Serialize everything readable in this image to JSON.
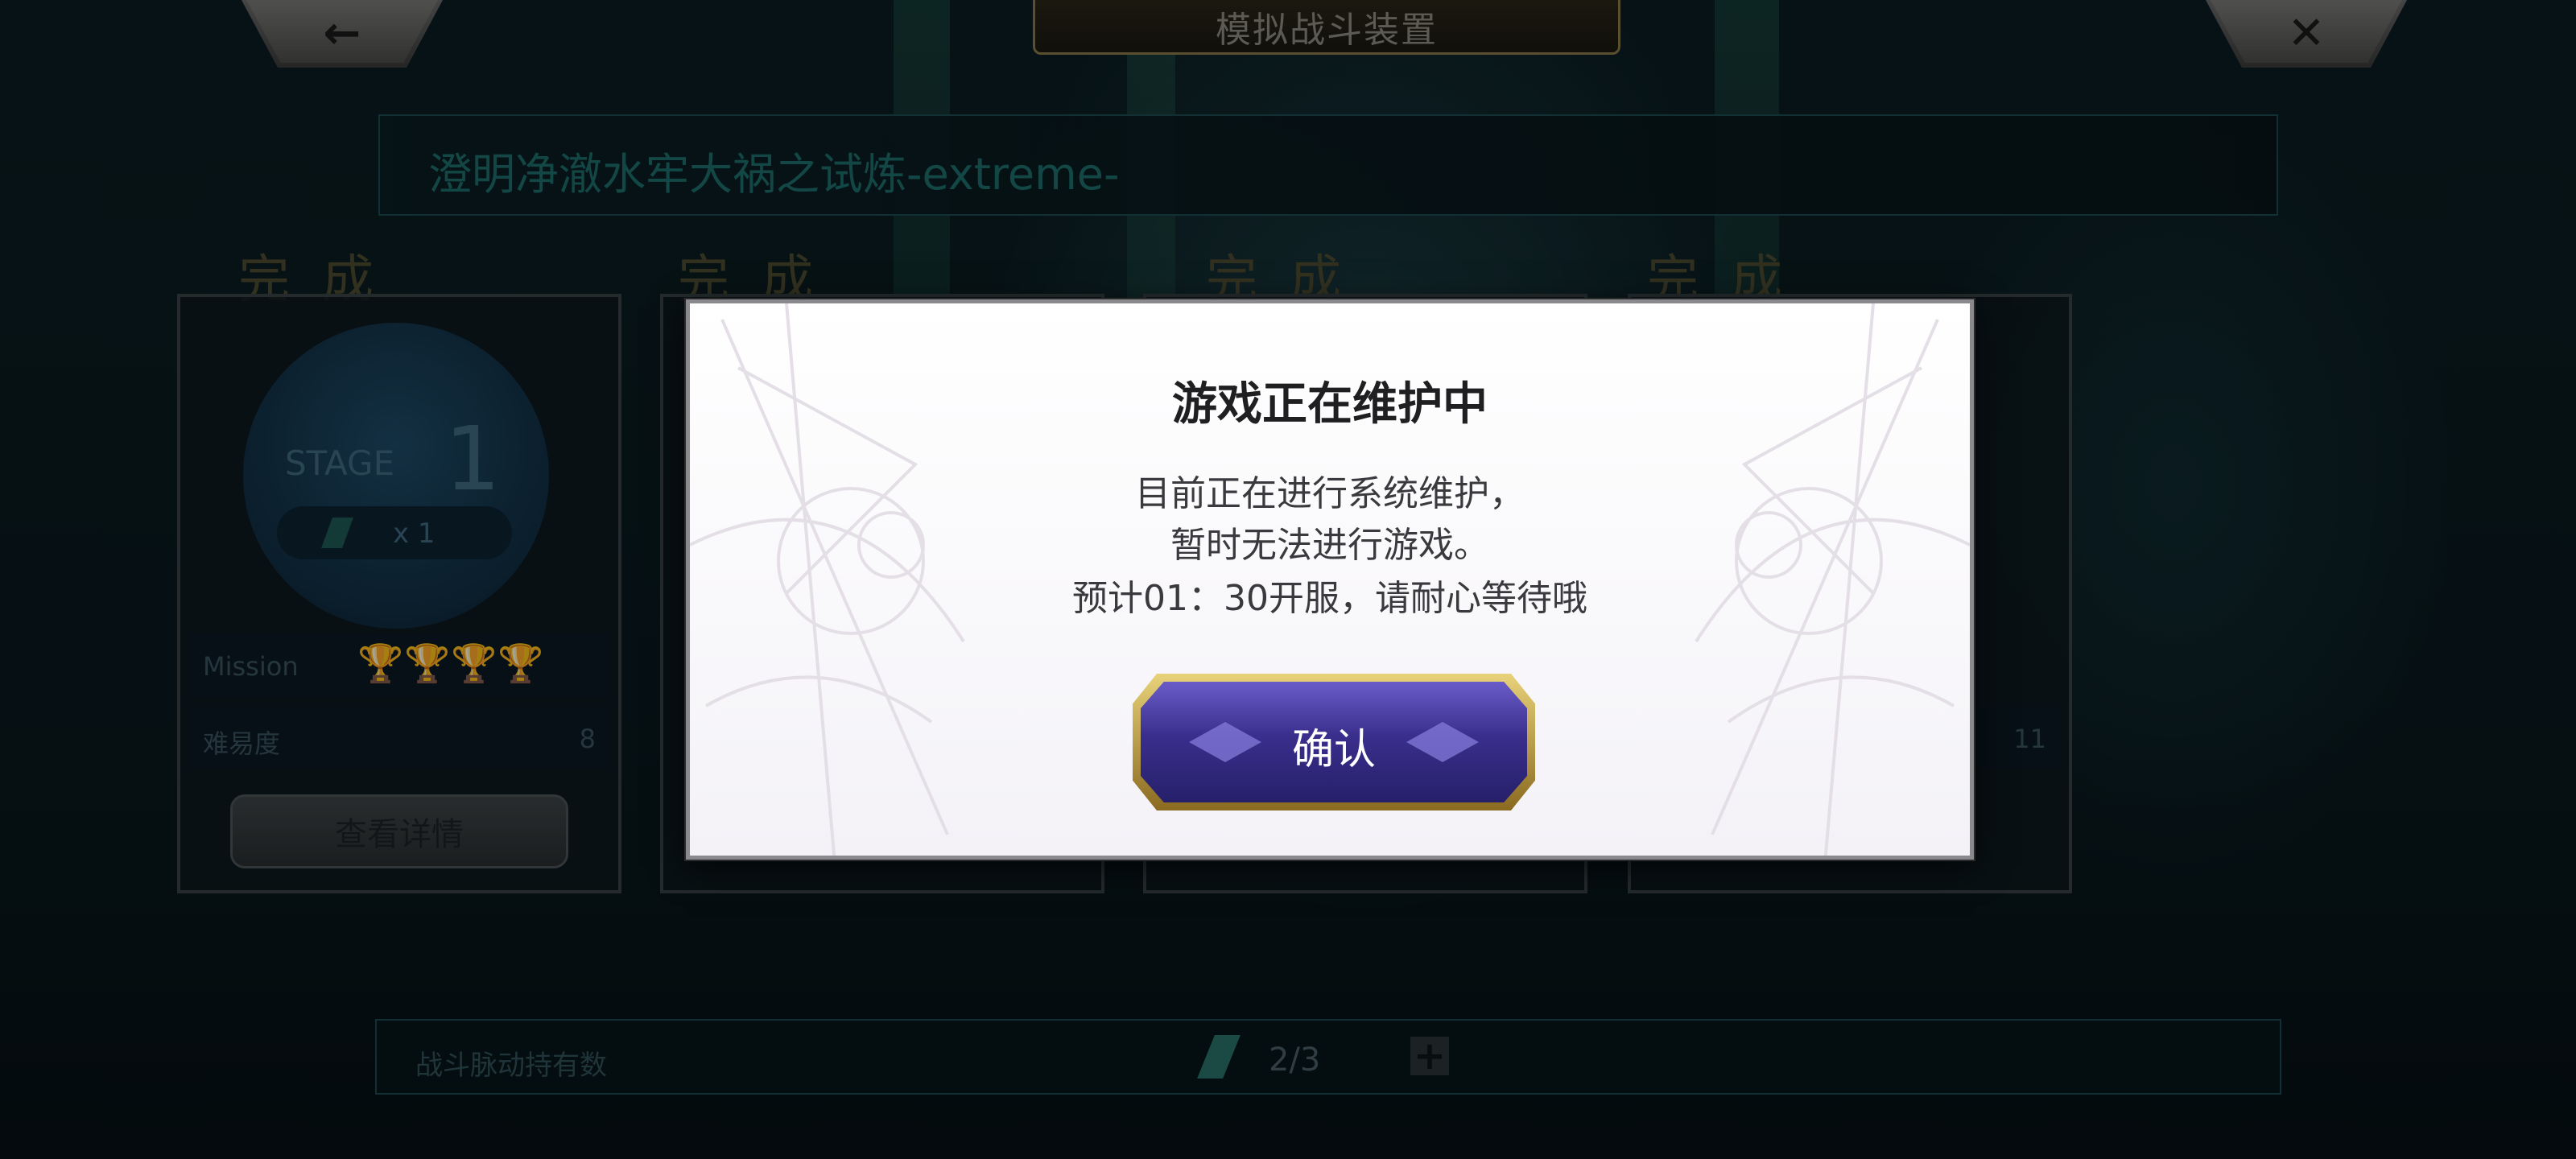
{
  "header": {
    "title": "模拟战斗装置",
    "back_icon": "←",
    "close_icon": "✕"
  },
  "stage_name": "澄明净澈水牢大祸之试炼-extreme-",
  "cards": [
    {
      "status": "完成",
      "stage_word": "STAGE",
      "stage_number": "1",
      "ticket_count": "x 1",
      "mission_label": "Mission",
      "difficulty_label": "难易度",
      "difficulty_value": "8",
      "detail_label": "查看详情"
    },
    {
      "status": "完成"
    },
    {
      "status": "完成"
    },
    {
      "status": "完成",
      "difficulty_value": "11"
    }
  ],
  "bottom_bar": {
    "label": "战斗脉动持有数",
    "count": "2/3",
    "plus_icon": "+"
  },
  "modal": {
    "title": "游戏正在维护中",
    "lines": [
      "目前正在进行系统维护，",
      "暂时无法进行游戏。",
      "预计01：30开服，请耐心等待哦"
    ],
    "confirm_label": "确认"
  },
  "colors": {
    "modal_bg": "#ffffff",
    "confirm_button": "#3a2e8c",
    "confirm_border": "#e8d27a"
  }
}
